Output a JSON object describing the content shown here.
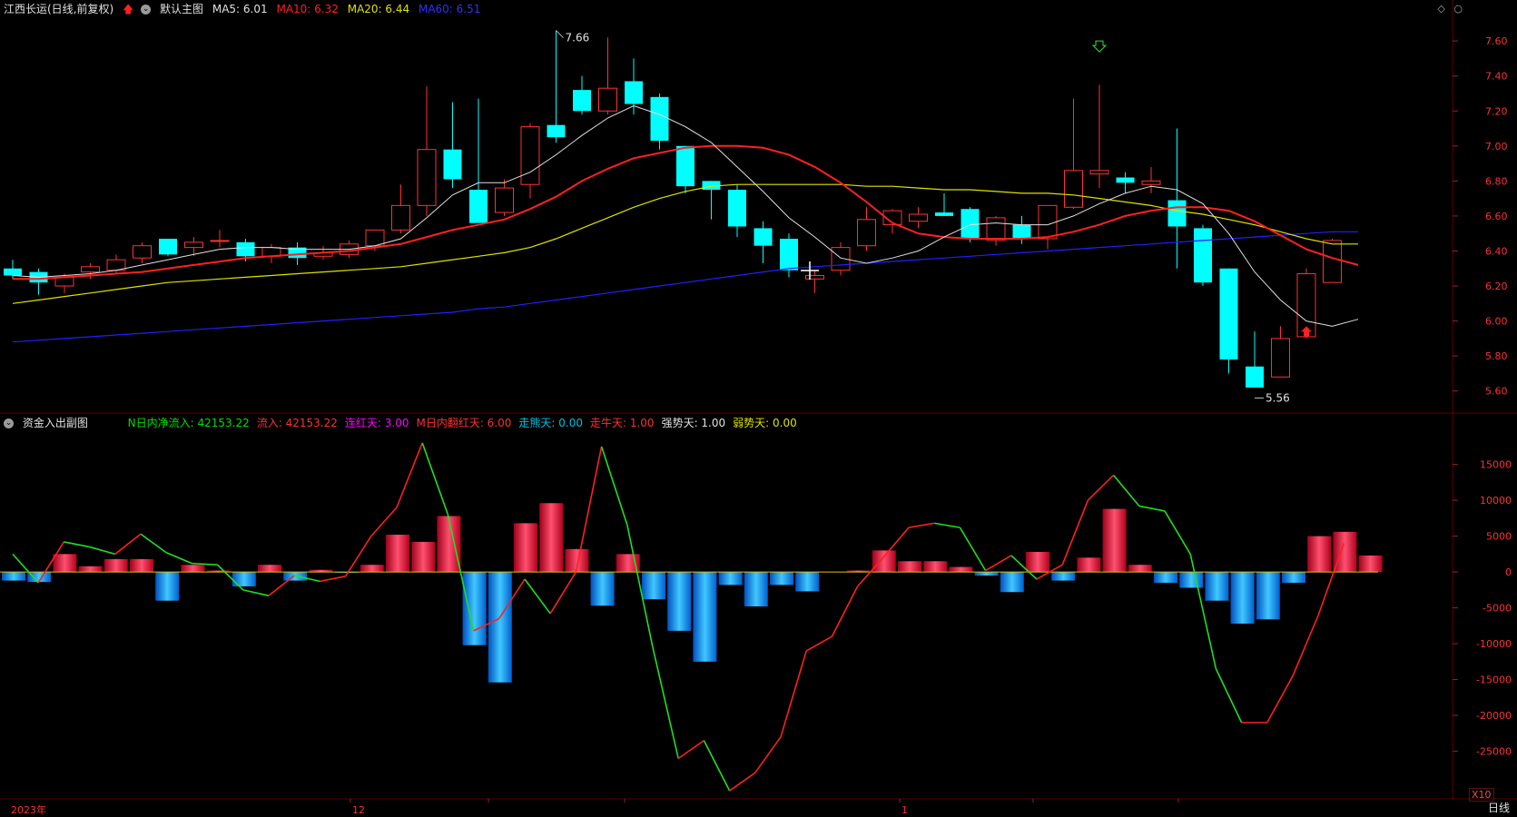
{
  "header": {
    "stock_name": "江西长运(日线,前复权)",
    "main_indicator": "默认主图",
    "ma5": "MA5: 6.01",
    "ma10": "MA10: 6.32",
    "ma20": "MA20: 6.44",
    "ma60": "MA60: 6.51"
  },
  "sub_header": {
    "title": "资金入出副图",
    "items": [
      {
        "text": "N日内净流入: 42153.22",
        "color": "#00e000"
      },
      {
        "text": "流入: 42153.22",
        "color": "#ff3030"
      },
      {
        "text": "连红天: 3.00",
        "color": "#ff00ff"
      },
      {
        "text": "M日内翻红天: 6.00",
        "color": "#ff3030"
      },
      {
        "text": "走熊天: 0.00",
        "color": "#00c0e0"
      },
      {
        "text": "走牛天: 1.00",
        "color": "#ff3030"
      },
      {
        "text": "强势天: 1.00",
        "color": "#e0e0e0"
      },
      {
        "text": "弱势天: 0.00",
        "color": "#e0e000"
      }
    ]
  },
  "annotations": {
    "high": "7.66",
    "low": "5.56"
  },
  "bottom": {
    "year_label": "2023年",
    "month_12": "12",
    "month_1": "1",
    "period": "日线",
    "zoom": "X10"
  },
  "colors": {
    "up": "#ff3232",
    "down": "#00ffff",
    "ma5": "#e0e0e0",
    "ma10": "#ff2020",
    "ma20": "#e0e000",
    "ma60": "#2020ff",
    "grid": "#5a0000"
  },
  "chart_data": [
    {
      "type": "candlestick",
      "yticks": [
        "7.60",
        "7.40",
        "7.20",
        "7.00",
        "6.80",
        "6.60",
        "6.40",
        "6.20",
        "6.00",
        "5.80",
        "5.60"
      ],
      "ylim": [
        5.5,
        7.72
      ],
      "candles": [
        [
          6.3,
          6.35,
          6.24,
          6.26
        ],
        [
          6.28,
          6.3,
          6.15,
          6.22
        ],
        [
          6.2,
          6.27,
          6.16,
          6.25
        ],
        [
          6.28,
          6.33,
          6.24,
          6.31
        ],
        [
          6.29,
          6.38,
          6.27,
          6.35
        ],
        [
          6.36,
          6.45,
          6.33,
          6.43
        ],
        [
          6.47,
          6.47,
          6.37,
          6.38
        ],
        [
          6.42,
          6.48,
          6.37,
          6.45
        ],
        [
          6.46,
          6.52,
          6.42,
          6.46
        ],
        [
          6.45,
          6.47,
          6.34,
          6.37
        ],
        [
          6.37,
          6.44,
          6.33,
          6.42
        ],
        [
          6.42,
          6.45,
          6.32,
          6.36
        ],
        [
          6.37,
          6.43,
          6.35,
          6.39
        ],
        [
          6.38,
          6.46,
          6.36,
          6.44
        ],
        [
          6.43,
          6.52,
          6.4,
          6.52
        ],
        [
          6.52,
          6.78,
          6.5,
          6.66
        ],
        [
          6.66,
          7.34,
          6.6,
          6.98
        ],
        [
          6.98,
          7.25,
          6.76,
          6.81
        ],
        [
          6.75,
          7.27,
          6.7,
          6.56
        ],
        [
          6.62,
          6.81,
          6.6,
          6.76
        ],
        [
          6.78,
          7.13,
          6.7,
          7.11
        ],
        [
          7.12,
          7.66,
          7.02,
          7.05
        ],
        [
          7.32,
          7.4,
          7.18,
          7.2
        ],
        [
          7.2,
          7.62,
          7.18,
          7.33
        ],
        [
          7.37,
          7.5,
          7.18,
          7.24
        ],
        [
          7.28,
          7.3,
          6.98,
          7.03
        ],
        [
          7.0,
          7.0,
          6.73,
          6.77
        ],
        [
          6.8,
          6.8,
          6.58,
          6.75
        ],
        [
          6.75,
          6.78,
          6.48,
          6.54
        ],
        [
          6.53,
          6.57,
          6.33,
          6.43
        ],
        [
          6.47,
          6.5,
          6.25,
          6.29
        ],
        [
          6.24,
          6.29,
          6.16,
          6.26
        ],
        [
          6.29,
          6.45,
          6.26,
          6.42
        ],
        [
          6.43,
          6.65,
          6.4,
          6.58
        ],
        [
          6.55,
          6.64,
          6.5,
          6.63
        ],
        [
          6.57,
          6.65,
          6.53,
          6.61
        ],
        [
          6.62,
          6.73,
          6.6,
          6.6
        ],
        [
          6.64,
          6.65,
          6.45,
          6.47
        ],
        [
          6.46,
          6.6,
          6.43,
          6.59
        ],
        [
          6.55,
          6.6,
          6.44,
          6.47
        ],
        [
          6.47,
          6.62,
          6.41,
          6.66
        ],
        [
          6.65,
          7.27,
          6.64,
          6.86
        ],
        [
          6.84,
          7.35,
          6.76,
          6.86
        ],
        [
          6.82,
          6.85,
          6.73,
          6.79
        ],
        [
          6.78,
          6.88,
          6.73,
          6.8
        ],
        [
          6.69,
          7.1,
          6.3,
          6.54
        ],
        [
          6.53,
          6.55,
          6.2,
          6.22
        ],
        [
          6.3,
          6.3,
          5.7,
          5.78
        ],
        [
          5.74,
          5.94,
          5.62,
          5.62
        ],
        [
          5.68,
          5.97,
          5.68,
          5.9
        ],
        [
          5.91,
          6.3,
          5.9,
          6.27
        ],
        [
          6.22,
          6.47,
          6.22,
          6.46
        ]
      ],
      "ma5": [
        6.26,
        6.25,
        6.26,
        6.27,
        6.29,
        6.32,
        6.35,
        6.38,
        6.41,
        6.42,
        6.42,
        6.41,
        6.41,
        6.41,
        6.43,
        6.47,
        6.59,
        6.72,
        6.79,
        6.79,
        6.85,
        6.95,
        7.06,
        7.16,
        7.23,
        7.18,
        7.11,
        7.02,
        6.88,
        6.74,
        6.59,
        6.48,
        6.36,
        6.33,
        6.36,
        6.4,
        6.48,
        6.55,
        6.56,
        6.55,
        6.55,
        6.6,
        6.67,
        6.73,
        6.77,
        6.75,
        6.67,
        6.5,
        6.28,
        6.12,
        6.0,
        5.97,
        6.01
      ],
      "ma10": [
        6.24,
        6.24,
        6.25,
        6.26,
        6.27,
        6.28,
        6.3,
        6.32,
        6.34,
        6.36,
        6.37,
        6.38,
        6.39,
        6.4,
        6.42,
        6.44,
        6.48,
        6.52,
        6.55,
        6.58,
        6.64,
        6.71,
        6.8,
        6.87,
        6.93,
        6.96,
        6.99,
        7.0,
        7.0,
        6.99,
        6.95,
        6.88,
        6.79,
        6.68,
        6.56,
        6.5,
        6.48,
        6.47,
        6.47,
        6.47,
        6.48,
        6.51,
        6.55,
        6.6,
        6.63,
        6.65,
        6.65,
        6.63,
        6.57,
        6.49,
        6.41,
        6.36,
        6.32
      ],
      "ma20": [
        6.1,
        6.12,
        6.14,
        6.16,
        6.18,
        6.2,
        6.22,
        6.23,
        6.24,
        6.25,
        6.26,
        6.27,
        6.28,
        6.29,
        6.3,
        6.31,
        6.33,
        6.35,
        6.37,
        6.39,
        6.42,
        6.47,
        6.53,
        6.59,
        6.65,
        6.7,
        6.74,
        6.77,
        6.78,
        6.78,
        6.78,
        6.78,
        6.78,
        6.77,
        6.77,
        6.76,
        6.75,
        6.75,
        6.74,
        6.73,
        6.73,
        6.72,
        6.7,
        6.68,
        6.66,
        6.63,
        6.61,
        6.58,
        6.55,
        6.51,
        6.47,
        6.44,
        6.44
      ],
      "ma60": [
        5.88,
        5.89,
        5.9,
        5.91,
        5.92,
        5.93,
        5.94,
        5.95,
        5.96,
        5.97,
        5.98,
        5.99,
        6.0,
        6.01,
        6.02,
        6.03,
        6.04,
        6.05,
        6.07,
        6.08,
        6.1,
        6.12,
        6.14,
        6.16,
        6.18,
        6.2,
        6.22,
        6.24,
        6.26,
        6.28,
        6.3,
        6.31,
        6.32,
        6.33,
        6.34,
        6.35,
        6.36,
        6.37,
        6.38,
        6.39,
        6.4,
        6.41,
        6.42,
        6.43,
        6.44,
        6.45,
        6.46,
        6.47,
        6.48,
        6.49,
        6.5,
        6.51,
        6.51
      ]
    },
    {
      "type": "bar",
      "yticks": [
        "15000",
        "10000",
        "5000",
        "0",
        "-5000",
        "-10000",
        "-15000",
        "-20000",
        "-25000"
      ],
      "ylim": [
        -31000,
        19000
      ],
      "bars": [
        -1200,
        -1400,
        2500,
        800,
        1800,
        1800,
        -4000,
        1000,
        200,
        -2000,
        1000,
        -1200,
        300,
        -100,
        1000,
        5200,
        4200,
        7800,
        -10200,
        -15400,
        6800,
        9600,
        3200,
        -4700,
        2500,
        -3800,
        -8200,
        -12500,
        -1800,
        -4800,
        -1800,
        -2700,
        0,
        200,
        3000,
        1500,
        1500,
        700,
        -500,
        -2800,
        2800,
        -1200,
        2000,
        8800,
        1000,
        -1500,
        -2200,
        -4000,
        -7200,
        -6600,
        -1500,
        5000,
        5600,
        2300
      ],
      "line": [
        2500,
        -1500,
        4200,
        3500,
        2500,
        5300,
        2700,
        1200,
        1000,
        -2500,
        -3300,
        -500,
        -1300,
        -600,
        5000,
        9000,
        18000,
        8000,
        -8200,
        -6500,
        -1000,
        -5800,
        0,
        17500,
        6600,
        -10500,
        -26000,
        -23500,
        -30500,
        -28000,
        -23000,
        -11000,
        -9000,
        -2000,
        2000,
        6200,
        6800,
        6200,
        200,
        2300,
        -1000,
        1000,
        10000,
        13500,
        9200,
        8500,
        2500,
        -13500,
        -21000,
        -21000,
        -14500,
        -6000,
        4000
      ]
    }
  ]
}
